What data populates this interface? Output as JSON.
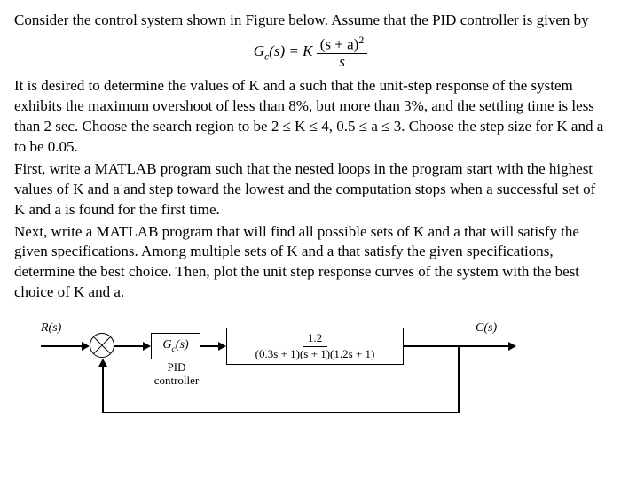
{
  "text": {
    "p1": "Consider the control system shown in Figure below. Assume that the PID controller is given by",
    "eq_lhs": "G",
    "eq_sub": "c",
    "eq_arg": "(s) = K",
    "eq_num": "(s + a)",
    "eq_sup": "2",
    "eq_den": "s",
    "p2": "It is desired to determine the values of K and a such that the unit-step response of the system exhibits the maximum overshoot of less than 8%, but more than 3%, and the settling time is less than 2 sec. Choose the search region to be 2 ≤ K ≤ 4, 0.5 ≤ a ≤ 3. Choose the step size for K and a to be 0.05.",
    "p3": "First, write a MATLAB program such that the nested loops in the program start with the highest values of K and a and step toward the lowest and the computation stops when a successful set of K and a is found for the first time.",
    "p4": "Next, write a MATLAB program that will find all possible sets of K and a that will satisfy the given specifications. Among multiple sets of K and a that satisfy the given specifications, determine the best choice. Then, plot the unit step response curves of the system with the best choice of K and a."
  },
  "diagram": {
    "r_label": "R(s)",
    "c_label": "C(s)",
    "gc_label": "G",
    "gc_sub": "c",
    "gc_arg": "(s)",
    "plant_num": "1.2",
    "plant_den": "(0.3s + 1)(s + 1)(1.2s + 1)",
    "pid_l1": "PID",
    "pid_l2": "controller"
  }
}
